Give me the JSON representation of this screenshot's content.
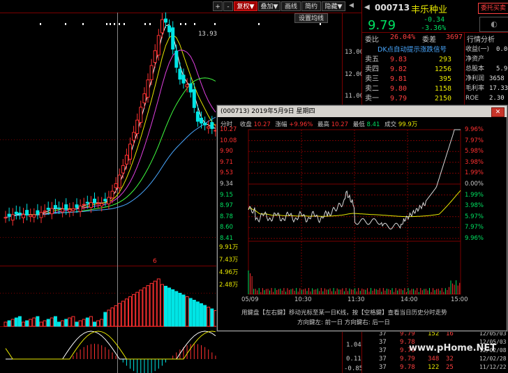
{
  "toolbar": {
    "buttons": [
      "+",
      "-",
      "复权▼",
      "叠加▼",
      "画线",
      "简约",
      "隐藏▼"
    ],
    "settings_label": "设置均线"
  },
  "kline_axis": [
    "13.00",
    "12.00",
    "11.00"
  ],
  "peak_label": "13.93",
  "vol_marker": "6",
  "macd_axis": [
    "1.04",
    "0.11",
    "-0.85"
  ],
  "stock": {
    "code": "000713",
    "name": "丰乐种业",
    "price": "9.79",
    "change": "-0.34",
    "change_pct": "-3.36%",
    "entrust_button": "委托买卖",
    "weibi_label": "委比",
    "weibi": "26.04%",
    "weicha_label": "委差",
    "weicha": "3697",
    "signal": "DK点自动提示涨跌信号",
    "ask_rows": [
      {
        "label": "卖五",
        "price": "9.83",
        "vol": "293"
      },
      {
        "label": "卖四",
        "price": "9.82",
        "vol": "1256"
      },
      {
        "label": "卖三",
        "price": "9.81",
        "vol": "395"
      },
      {
        "label": "卖二",
        "price": "9.80",
        "vol": "1158"
      },
      {
        "label": "卖一",
        "price": "9.79",
        "vol": "2150"
      }
    ],
    "fin_title": "行情分析",
    "fin_rows": [
      {
        "label": "收益(一)",
        "value": "0.08"
      },
      {
        "label": "净资产",
        "value": ""
      },
      {
        "label": "总股本",
        "value": "5.9"
      },
      {
        "label": "净利润",
        "value": "3658"
      },
      {
        "label": "毛利率",
        "value": "17.33"
      },
      {
        "label": "ROE",
        "value": "2.30"
      }
    ],
    "ticks": [
      {
        "t": "37",
        "p": "9.79",
        "v": "152",
        "n": "16"
      },
      {
        "t": "37",
        "p": "9.78",
        "v": "",
        "n": ""
      },
      {
        "t": "37",
        "p": "9.79",
        "v": "",
        "n": ""
      },
      {
        "t": "37",
        "p": "9.79",
        "v": "348",
        "n": "32"
      },
      {
        "t": "37",
        "p": "9.78",
        "v": "122",
        "n": "25"
      }
    ],
    "dates": [
      "12/05/03",
      "12/05/03",
      "12/02/08",
      "12/02/28",
      "11/12/22"
    ]
  },
  "watermark": "www.pHome.NET",
  "popup": {
    "title": "(000713)  2019年5月9日  星期四",
    "close": "✕",
    "info": {
      "time_label": "分时",
      "close_label": "收盘",
      "close_val": "10.27",
      "change_label": "涨幅",
      "change_val": "+9.96%",
      "high_label": "最高",
      "high_val": "10.27",
      "low_label": "最低",
      "low_val": "8.41",
      "amount_label": "成交",
      "amount_val": "99.9万"
    },
    "left_axis": [
      "10.27",
      "10.08",
      "9.90",
      "9.71",
      "9.53",
      "9.34",
      "9.15",
      "8.97",
      "8.78",
      "8.60",
      "8.41"
    ],
    "right_axis": [
      "9.96%",
      "7.97%",
      "5.98%",
      "3.98%",
      "1.99%",
      "0.00%",
      "1.99%",
      "3.98%",
      "5.97%",
      "7.97%",
      "9.96%"
    ],
    "vol_axis": [
      "9.91万",
      "7.43万",
      "4.96万",
      "2.48万"
    ],
    "time_axis": [
      "05/09",
      "10:30",
      "11:30",
      "14:00",
      "15:00"
    ],
    "hint1": "用鍵盘【左右鍵】移动光标至某一日K线，按【空格鍵】查看当日历史分时走势",
    "hint2": "方向鍵左: 前一日    方向鍵右: 后一日"
  },
  "colors": {
    "up": "#ff3030",
    "down": "#00e5e5",
    "yellow": "#e8e800",
    "bg": "#000000",
    "grid": "#7a0000"
  }
}
